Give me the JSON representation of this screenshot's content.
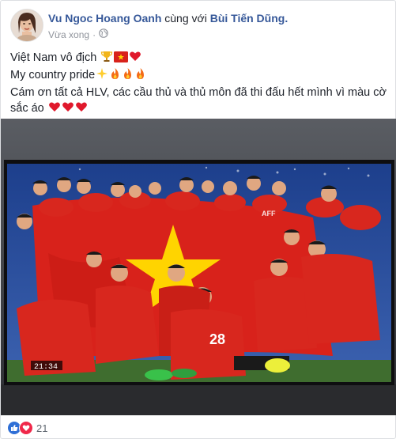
{
  "post": {
    "author": "Vu Ngoc Hoang Oanh",
    "with_text": "cùng với",
    "tagged": "Bùi Tiến Dũng.",
    "timestamp": "Vừa xong",
    "separator": "·",
    "privacy_icon": "globe-icon",
    "lines": [
      "Việt Nam vô địch",
      "My country pride",
      "Cám ơn tất cả HLV, các cầu thủ và thủ môn đã thi đấu hết mình vì màu cờ",
      "sắc áo"
    ],
    "line1_emojis": [
      "trophy-icon",
      "vietnam-flag-icon",
      "heart-icon"
    ],
    "line2_emojis": [
      "sparkle-icon",
      "fire-icon",
      "fire-icon",
      "fire-icon"
    ],
    "line4_emojis": [
      "heart-icon",
      "heart-icon",
      "heart-icon"
    ]
  },
  "photo": {
    "scoreboard_time": "21:34",
    "jersey_number": "28",
    "banner_text": "AFF"
  },
  "reactions": {
    "types": [
      "like-icon",
      "love-icon"
    ],
    "count": "21"
  },
  "colors": {
    "link": "#365899",
    "text": "#1d2129",
    "meta": "#90949c",
    "flag_red": "#d8221b",
    "flag_star": "#ffd400"
  }
}
